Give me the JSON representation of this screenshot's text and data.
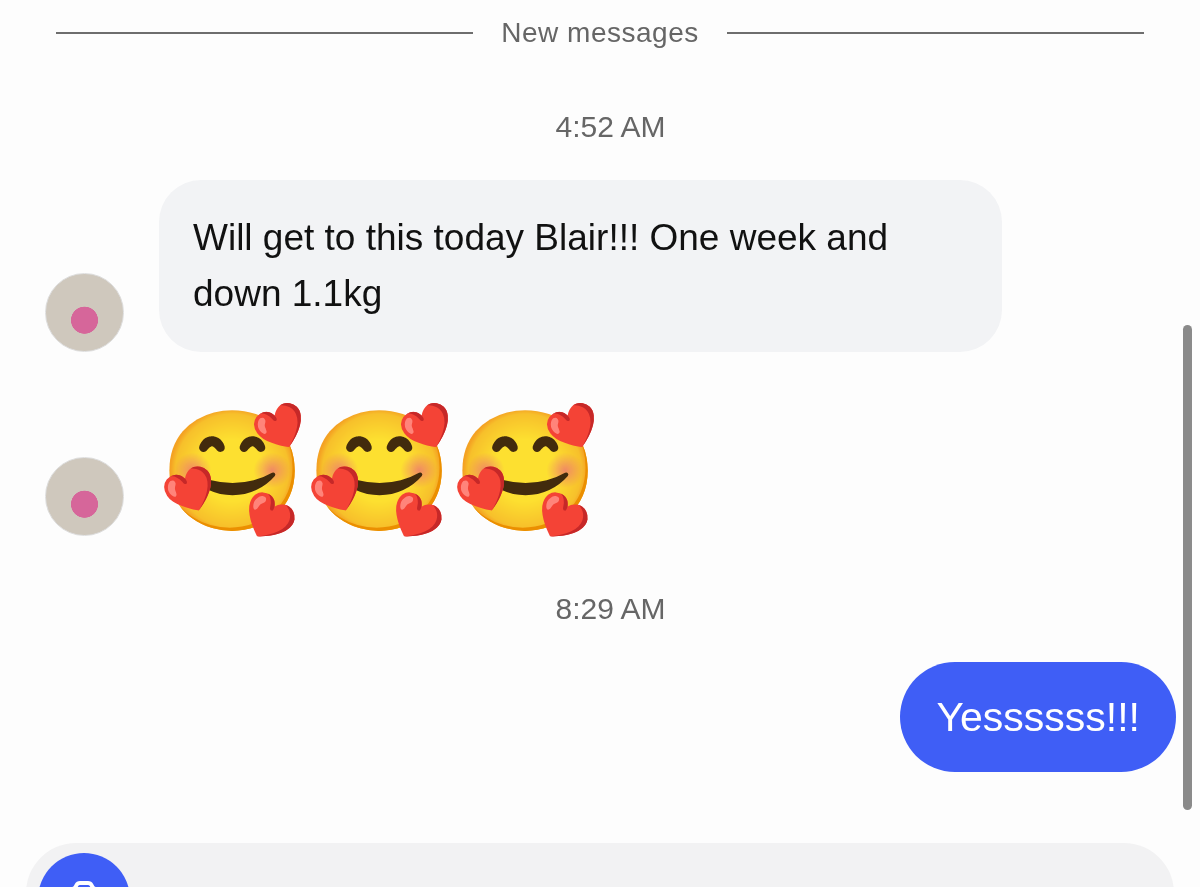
{
  "divider": {
    "label": "New messages"
  },
  "messages": [
    {
      "kind": "time",
      "text": "4:52 AM"
    },
    {
      "kind": "received",
      "text": "Will get to this today Blair!!! One week and down 1.1kg"
    },
    {
      "kind": "emoji",
      "text": "🥰🥰🥰"
    },
    {
      "kind": "time",
      "text": "8:29 AM"
    },
    {
      "kind": "sent",
      "text": "Yessssss!!!"
    }
  ]
}
